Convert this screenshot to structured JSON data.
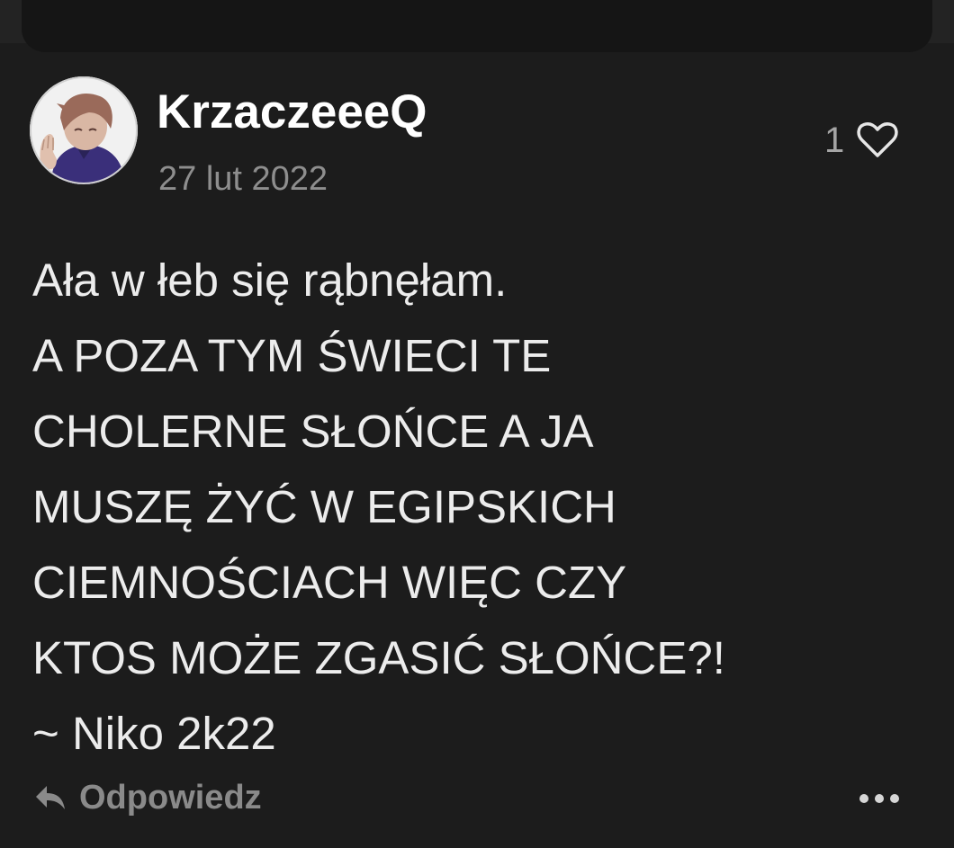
{
  "post": {
    "author": "KrzaczeeeQ",
    "date": "27 lut 2022",
    "likes": "1",
    "lines": [
      "Ała w łeb się rąbnęłam.",
      "A POZA TYM ŚWIECI TE",
      "CHOLERNE SŁOŃCE A JA",
      "MUSZĘ ŻYĆ W EGIPSKICH",
      "CIEMNOŚCIACH WIĘC CZY",
      "KTOS MOŻE ZGASIĆ SŁOŃCE?!",
      "~ Niko 2k22"
    ]
  },
  "actions": {
    "reply_label": "Odpowiedz"
  },
  "icons": {
    "like": "heart-outline-icon",
    "reply": "reply-arrow-icon",
    "more": "more-dots-icon"
  },
  "colors": {
    "background": "#1c1c1c",
    "text": "#ececec",
    "muted": "#8e8e8e"
  }
}
